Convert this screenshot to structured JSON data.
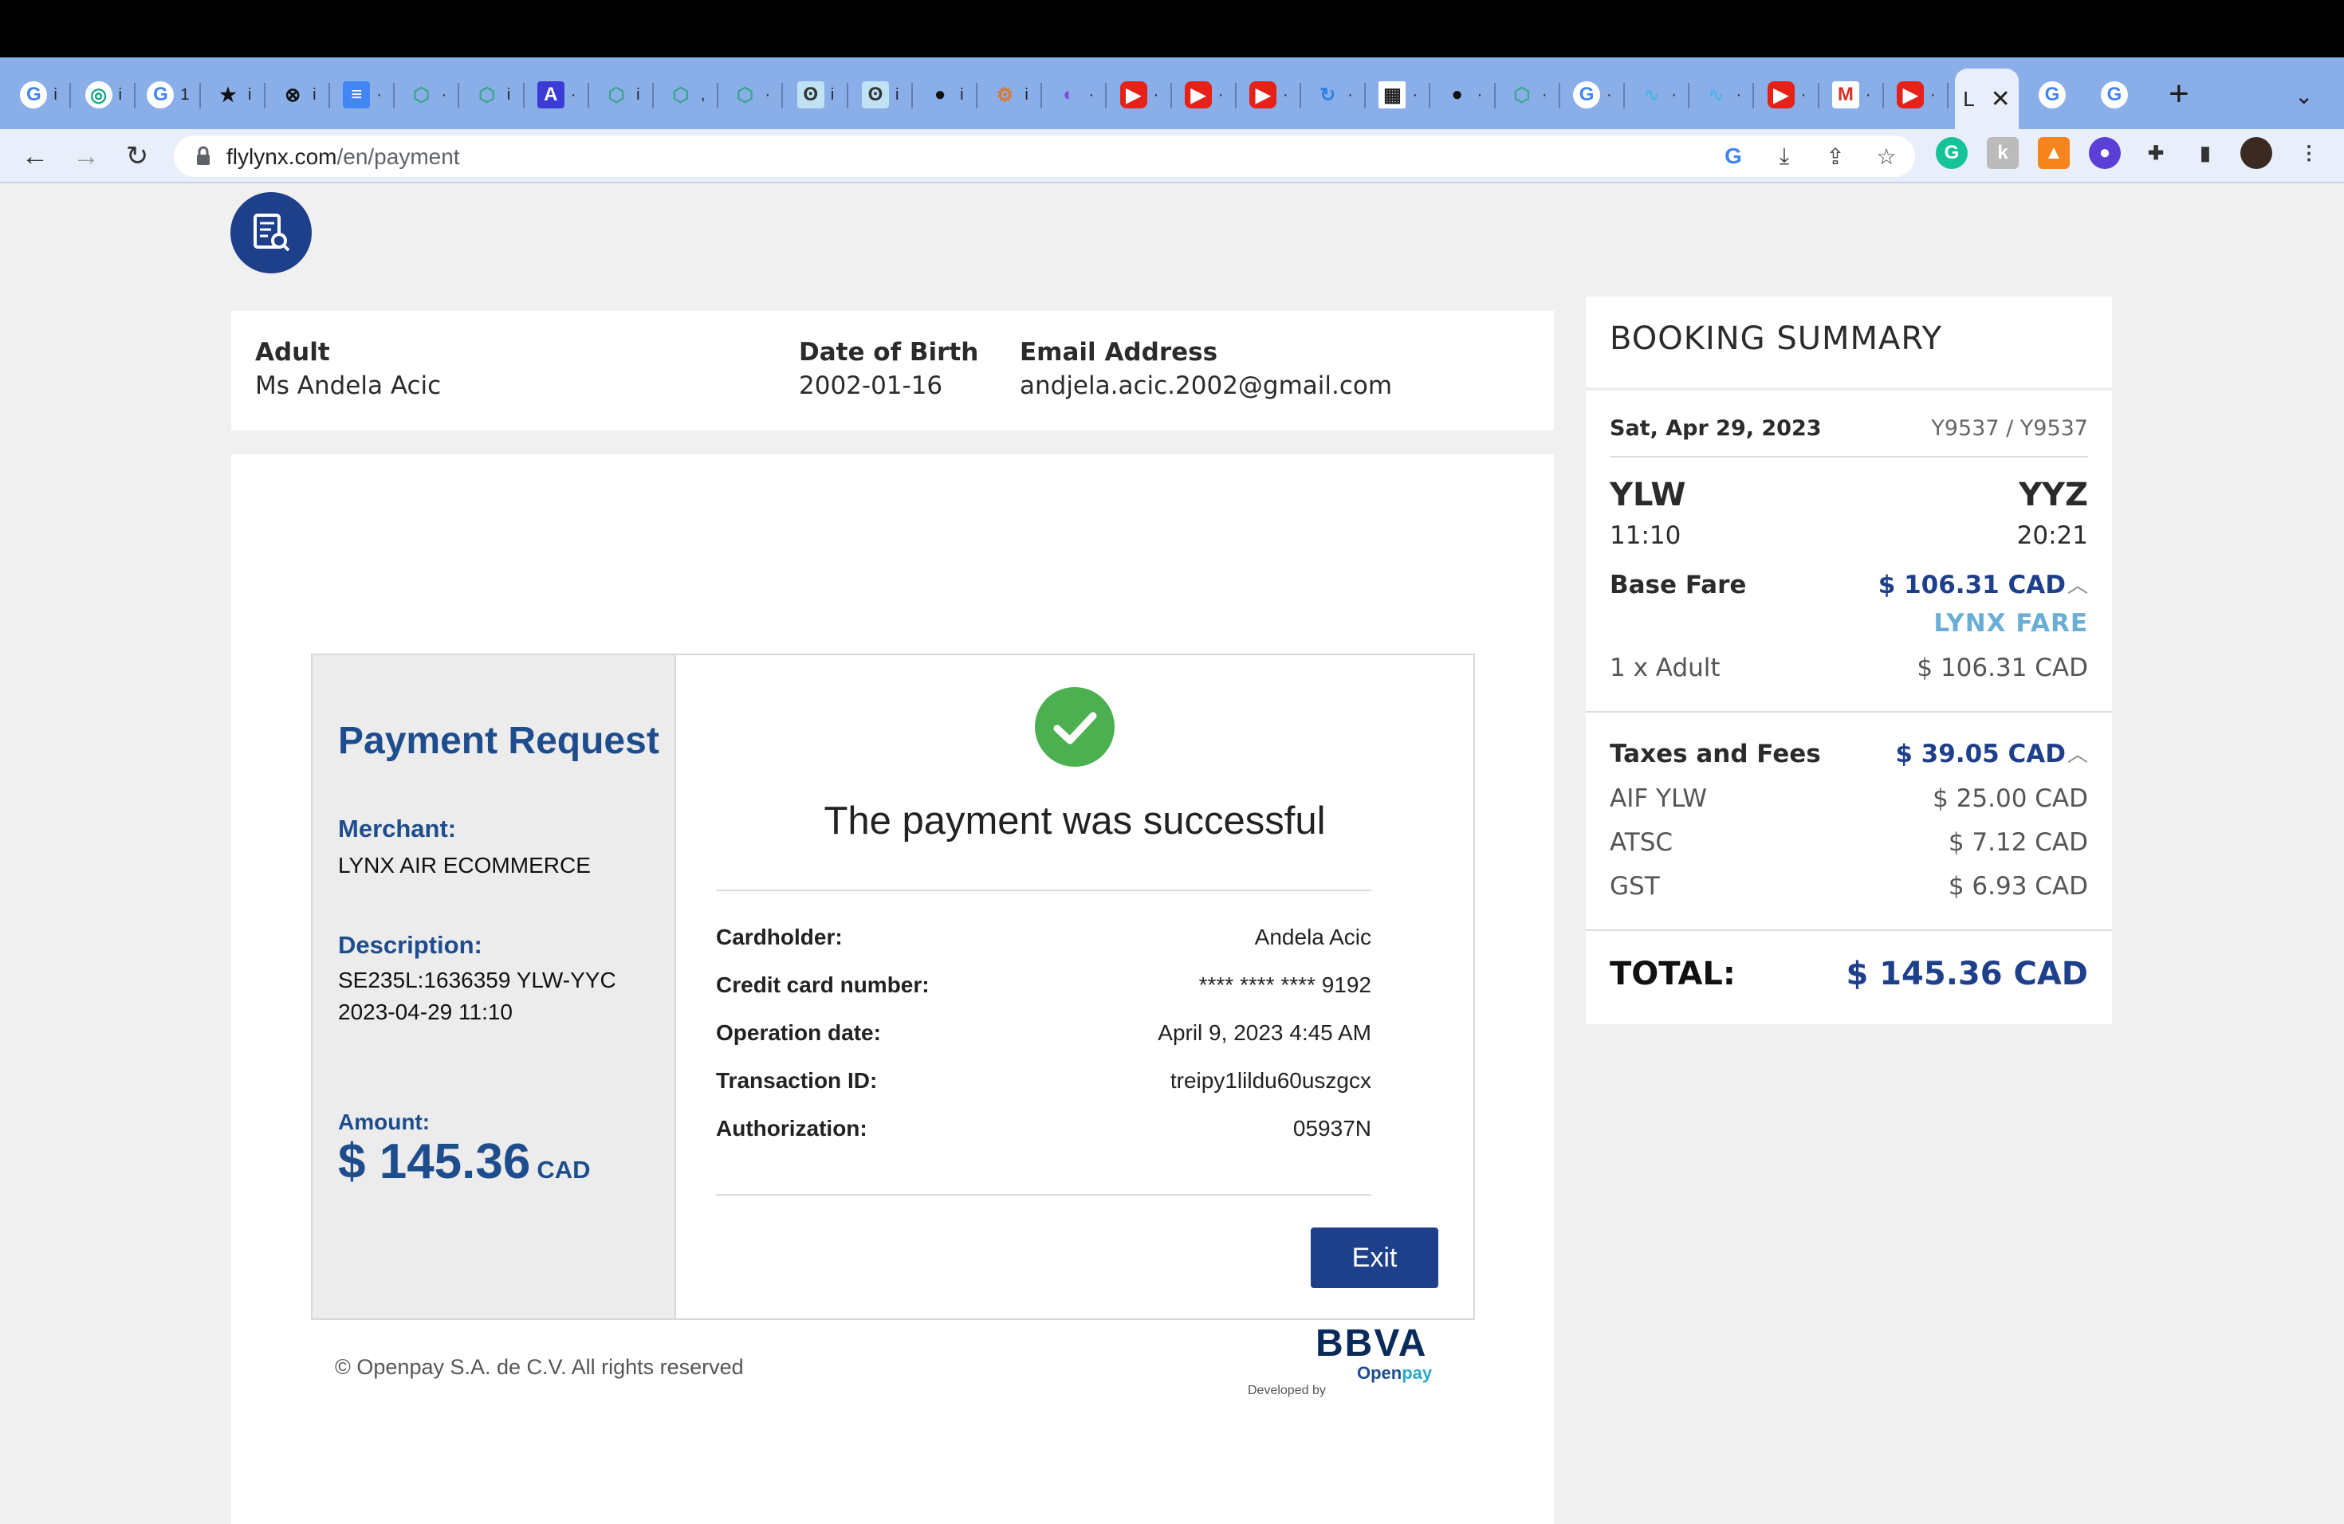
{
  "browser": {
    "url_domain": "flylynx.com",
    "url_path": "/en/payment",
    "active_tab_label": "L",
    "tab_label_i": "i",
    "tab_label_1": "1",
    "tab_label_dot": "·",
    "tab_label_comma": ",",
    "tab_icons": [
      "google-icon",
      "openai-icon",
      "google-icon",
      "star-icon",
      "x-circle-icon",
      "docs-icon",
      "cube-icon",
      "cube-icon",
      "ai-icon",
      "cube-icon",
      "cube-icon",
      "cube-icon",
      "gopher-icon",
      "gopher-icon",
      "github-icon",
      "rust-icon",
      "spiral-icon",
      "youtube-icon",
      "youtube-icon",
      "youtube-icon",
      "loop-icon",
      "qr-icon",
      "github-icon",
      "cube-icon",
      "google-icon",
      "gradient-icon",
      "gradient-icon",
      "youtube-icon",
      "gmail-icon",
      "youtube-icon"
    ]
  },
  "passenger": {
    "type_label": "Adult",
    "name": "Ms Andela Acic",
    "dob_label": "Date of Birth",
    "dob": "2002-01-16",
    "email_label": "Email Address",
    "email": "andjela.acic.2002@gmail.com"
  },
  "payment": {
    "title": "Payment Request",
    "merchant_label": "Merchant:",
    "merchant": "LYNX AIR ECOMMERCE",
    "description_label": "Description:",
    "description_line1": "SE235L:1636359 YLW-YYC",
    "description_line2": "2023-04-29 11:10",
    "amount_label": "Amount:",
    "amount": "$ 145.36",
    "amount_currency": "CAD",
    "success_message": "The payment was successful",
    "details": [
      {
        "label": "Cardholder:",
        "value": "Andela Acic"
      },
      {
        "label": "Credit card number:",
        "value": "**** **** **** 9192"
      },
      {
        "label": "Operation date:",
        "value": "April 9, 2023 4:45 AM"
      },
      {
        "label": "Transaction ID:",
        "value": "treipy1lildu60uszgcx"
      },
      {
        "label": "Authorization:",
        "value": "05937N"
      }
    ],
    "exit_label": "Exit",
    "copyright": "© Openpay S.A. de C.V. All rights reserved",
    "bbva": "BBVA",
    "openpay_a": "Open",
    "openpay_b": "pay",
    "developed_by": "Developed by"
  },
  "summary": {
    "title": "BOOKING SUMMARY",
    "date": "Sat, Apr 29, 2023",
    "flight": "Y9537 / Y9537",
    "origin": "YLW",
    "origin_time": "11:10",
    "destination": "YYZ",
    "destination_time": "20:21",
    "base_fare_label": "Base Fare",
    "base_fare": "$ 106.31 CAD",
    "fare_name": "LYNX FARE",
    "adult_label": "1 x Adult",
    "adult_value": "$ 106.31 CAD",
    "taxes_label": "Taxes and Fees",
    "taxes": "$ 39.05 CAD",
    "fees": [
      {
        "label": "AIF YLW",
        "value": "$ 25.00 CAD"
      },
      {
        "label": "ATSC",
        "value": "$ 7.12 CAD"
      },
      {
        "label": "GST",
        "value": "$ 6.93 CAD"
      }
    ],
    "total_label": "TOTAL:",
    "total": "$ 145.36 CAD"
  },
  "colors": {
    "brand_blue": "#1e3f8a",
    "success_green": "#4caf50",
    "fare_light_blue": "#6aaed6"
  }
}
